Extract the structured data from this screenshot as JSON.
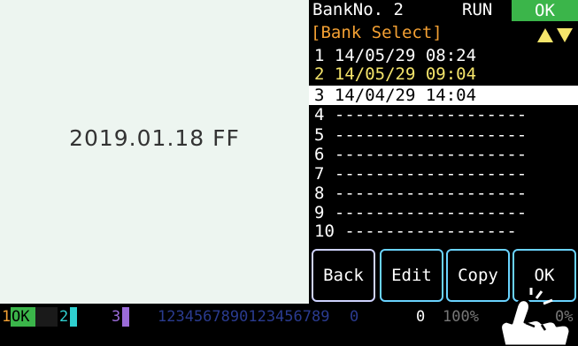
{
  "main": {
    "date_text": "2019.01.18 FF"
  },
  "panel": {
    "bank_label": "BankNo. 2",
    "run_label": "RUN",
    "ok_status": "OK",
    "title": "[Bank Select]",
    "arrows_icon": "up-down-arrows-icon",
    "items": [
      {
        "label": "1 14/05/29 08:24"
      },
      {
        "label": "2 14/05/29 09:04"
      },
      {
        "label": "3 14/04/29 14:04"
      },
      {
        "label": "4 -------------------"
      },
      {
        "label": "5 -------------------"
      },
      {
        "label": "6 -------------------"
      },
      {
        "label": "7 -------------------"
      },
      {
        "label": "8 -------------------"
      },
      {
        "label": "9 -------------------"
      },
      {
        "label": "10 -----------------"
      }
    ],
    "buttons": {
      "back": "Back",
      "edit": "Edit",
      "copy": "Copy",
      "ok": "OK"
    }
  },
  "status_bar": {
    "s1_num": "1",
    "s1_ok": "OK",
    "s2_num": "2",
    "s3_num": "3",
    "digits": "1234567890123456789",
    "digits_tail": "0",
    "zero": "0",
    "percent_left": "100%",
    "percent_right": "0%"
  },
  "colors": {
    "ok_green": "#3bb54a",
    "title_orange": "#f3a033",
    "current_yellow": "#f5e56b",
    "button_border": "#6ad3ff"
  }
}
